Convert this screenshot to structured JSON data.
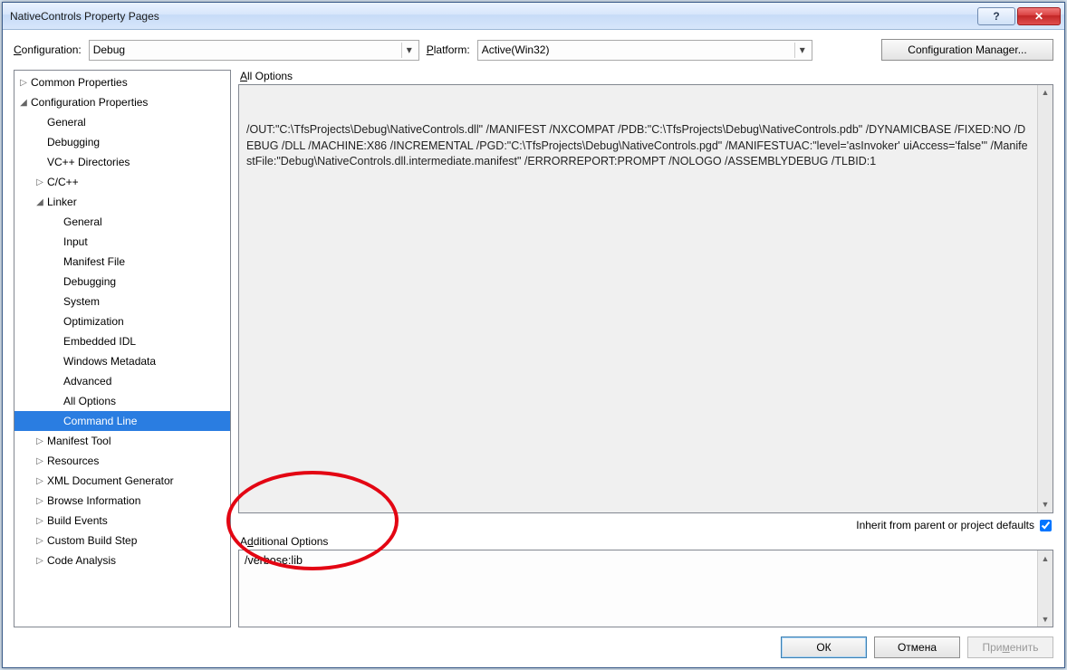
{
  "window": {
    "title": "NativeControls Property Pages"
  },
  "toolbar": {
    "configuration_label_pre": "C",
    "configuration_label_post": "onfiguration:",
    "configuration_value": "Debug",
    "platform_label_pre": "P",
    "platform_label_post": "latform:",
    "platform_value": "Active(Win32)",
    "config_manager": "Configuration Manager..."
  },
  "tree": {
    "items": [
      {
        "depth": 0,
        "label": "Common Properties",
        "expander": "▷"
      },
      {
        "depth": 0,
        "label": "Configuration Properties",
        "expander": "◢"
      },
      {
        "depth": 1,
        "label": "General",
        "expander": ""
      },
      {
        "depth": 1,
        "label": "Debugging",
        "expander": ""
      },
      {
        "depth": 1,
        "label": "VC++ Directories",
        "expander": ""
      },
      {
        "depth": 1,
        "label": "C/C++",
        "expander": "▷"
      },
      {
        "depth": 1,
        "label": "Linker",
        "expander": "◢"
      },
      {
        "depth": 2,
        "label": "General",
        "expander": ""
      },
      {
        "depth": 2,
        "label": "Input",
        "expander": ""
      },
      {
        "depth": 2,
        "label": "Manifest File",
        "expander": ""
      },
      {
        "depth": 2,
        "label": "Debugging",
        "expander": ""
      },
      {
        "depth": 2,
        "label": "System",
        "expander": ""
      },
      {
        "depth": 2,
        "label": "Optimization",
        "expander": ""
      },
      {
        "depth": 2,
        "label": "Embedded IDL",
        "expander": ""
      },
      {
        "depth": 2,
        "label": "Windows Metadata",
        "expander": ""
      },
      {
        "depth": 2,
        "label": "Advanced",
        "expander": ""
      },
      {
        "depth": 2,
        "label": "All Options",
        "expander": ""
      },
      {
        "depth": 2,
        "label": "Command Line",
        "expander": "",
        "selected": true
      },
      {
        "depth": 1,
        "label": "Manifest Tool",
        "expander": "▷"
      },
      {
        "depth": 1,
        "label": "Resources",
        "expander": "▷"
      },
      {
        "depth": 1,
        "label": "XML Document Generator",
        "expander": "▷"
      },
      {
        "depth": 1,
        "label": "Browse Information",
        "expander": "▷"
      },
      {
        "depth": 1,
        "label": "Build Events",
        "expander": "▷"
      },
      {
        "depth": 1,
        "label": "Custom Build Step",
        "expander": "▷"
      },
      {
        "depth": 1,
        "label": "Code Analysis",
        "expander": "▷"
      }
    ]
  },
  "right": {
    "all_options_label": "ll Options",
    "all_options_label_pre": "A",
    "all_options_text": "/OUT:\"C:\\TfsProjects\\Debug\\NativeControls.dll\" /MANIFEST /NXCOMPAT /PDB:\"C:\\TfsProjects\\Debug\\NativeControls.pdb\" /DYNAMICBASE /FIXED:NO /DEBUG /DLL /MACHINE:X86 /INCREMENTAL /PGD:\"C:\\TfsProjects\\Debug\\NativeControls.pgd\" /MANIFESTUAC:\"level='asInvoker' uiAccess='false'\" /ManifestFile:\"Debug\\NativeControls.dll.intermediate.manifest\" /ERRORREPORT:PROMPT /NOLOGO /ASSEMBLYDEBUG /TLBID:1",
    "inherit_label": "Inherit from parent or project defaults",
    "inherit_checked": true,
    "additional_label_pre": "A",
    "additional_label_und": "d",
    "additional_label_post": "ditional Options",
    "additional_text": "/verbose:lib"
  },
  "buttons": {
    "ok": "ОК",
    "cancel": "Отмена",
    "apply_pre": "При",
    "apply_und": "м",
    "apply_post": "енить"
  }
}
